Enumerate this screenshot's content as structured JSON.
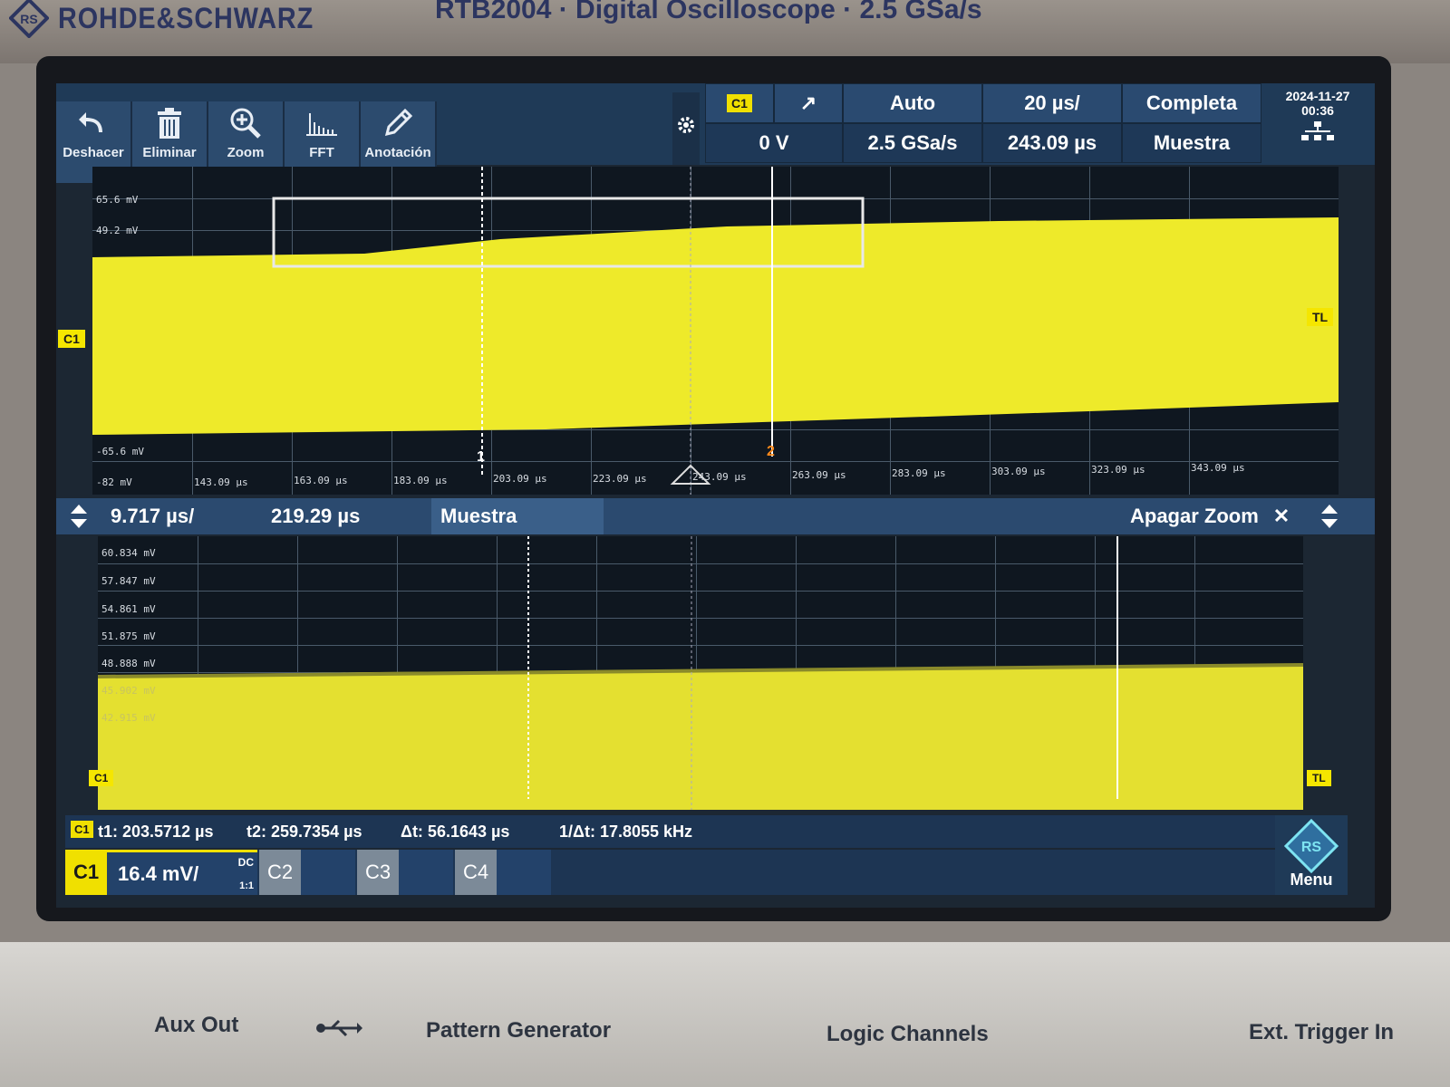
{
  "device": {
    "brand": "ROHDE&SCHWARZ",
    "model_text": "RTB2004 · Digital Oscilloscope · 2.5 GSa/s"
  },
  "toolbar": {
    "tools": [
      {
        "label": "Deshacer",
        "icon": "undo-icon"
      },
      {
        "label": "Eliminar",
        "icon": "trash-icon"
      },
      {
        "label": "Zoom",
        "icon": "zoom-icon"
      },
      {
        "label": "FFT",
        "icon": "fft-icon"
      },
      {
        "label": "Anotación",
        "icon": "pencil-icon"
      }
    ]
  },
  "status": {
    "trigger_source": "C1",
    "trigger_slope": "↗",
    "trigger_mode": "Auto",
    "timebase": "20 µs/",
    "acquisition": "Completa",
    "trigger_level": "0 V",
    "sample_rate": "2.5 GSa/s",
    "horizontal_position": "243.09 µs",
    "acq_mode": "Muestra",
    "date": "2024-11-27",
    "time": "00:36"
  },
  "main_plot": {
    "y_labels": [
      "65.6 mV",
      "49.2 mV",
      "-65.6 mV",
      "-82 mV"
    ],
    "x_labels": [
      "143.09 µs",
      "163.09 µs",
      "183.09 µs",
      "203.09 µs",
      "223.09 µs",
      "243.09 µs",
      "263.09 µs",
      "283.09 µs",
      "303.09 µs",
      "323.09 µs",
      "343.09 µs"
    ],
    "channel_marker": "C1",
    "trigger_marker": "TL",
    "cursor1": "1",
    "cursor2": "2"
  },
  "zoom_bar": {
    "zoom_timebase": "9.717 µs/",
    "zoom_position": "219.29 µs",
    "zoom_mode": "Muestra",
    "close_label": "Apagar Zoom",
    "close_icon": "✕"
  },
  "zoom_plot": {
    "y_labels": [
      "60.834 mV",
      "57.847 mV",
      "54.861 mV",
      "51.875 mV",
      "48.888 mV",
      "45.902 mV",
      "42.915 mV"
    ],
    "channel_marker": "C1",
    "trigger_marker": "TL"
  },
  "measurements": {
    "channel": "C1",
    "t1": "t1: 203.5712 µs",
    "t2": "t2: 259.7354 µs",
    "dt": "Δt: 56.1643 µs",
    "inv_dt": "1/Δt: 17.8055 kHz"
  },
  "channels": [
    {
      "name": "C1",
      "scale": "16.4 mV/",
      "coupling": "DC",
      "ratio": "1:1",
      "color": "#f0e000"
    },
    {
      "name": "C2"
    },
    {
      "name": "C3"
    },
    {
      "name": "C4"
    }
  ],
  "menu_label": "Menu",
  "front_panel": {
    "aux_out": "Aux Out",
    "pattern_generator": "Pattern Generator",
    "logic_channels": "Logic Channels",
    "ext_trigger_in": "Ext. Trigger In"
  },
  "colors": {
    "trace": "#eeea2a",
    "accent": "#2a4a70",
    "background": "#0f1720"
  }
}
